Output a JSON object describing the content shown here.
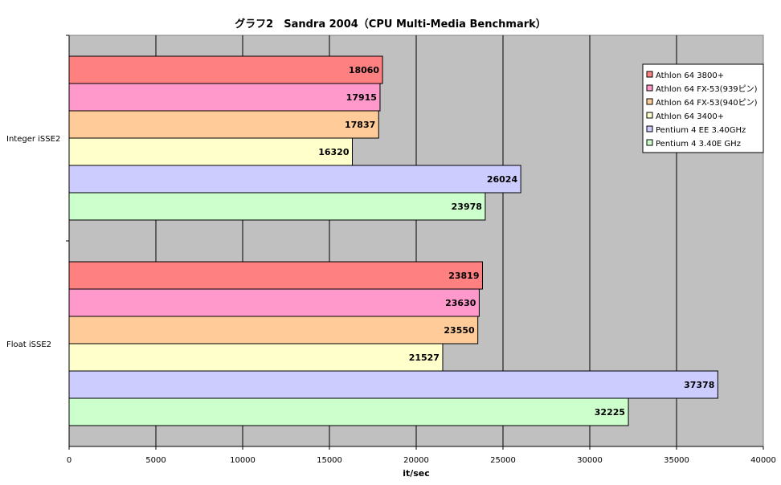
{
  "chart_data": {
    "type": "bar",
    "orientation": "horizontal",
    "title": "グラフ2　Sandra 2004（CPU Multi-Media Benchmark）",
    "xlabel": "it/sec",
    "xlim": [
      0,
      40000
    ],
    "xticks": [
      0,
      5000,
      10000,
      15000,
      20000,
      25000,
      30000,
      35000,
      40000
    ],
    "categories": [
      "Integer iSSE2",
      "Float iSSE2"
    ],
    "grid": true,
    "legend_position": "top-right",
    "series": [
      {
        "name": "Athlon 64 3800+",
        "color": "#ff8080",
        "values": [
          18060,
          23819
        ]
      },
      {
        "name": "Athlon 64 FX-53(939ピン)",
        "color": "#ff99cc",
        "values": [
          17915,
          23630
        ]
      },
      {
        "name": "Athlon 64 FX-53(940ピン)",
        "color": "#ffcc99",
        "values": [
          17837,
          23550
        ]
      },
      {
        "name": "Athlon 64 3400+",
        "color": "#ffffcc",
        "values": [
          16320,
          21527
        ]
      },
      {
        "name": "Pentium 4 EE 3.40GHz",
        "color": "#ccccff",
        "values": [
          26024,
          37378
        ]
      },
      {
        "name": "Pentium 4 3.40E GHz",
        "color": "#ccffcc",
        "values": [
          23978,
          32225
        ]
      }
    ],
    "plot_background": "#c0c0c0"
  }
}
